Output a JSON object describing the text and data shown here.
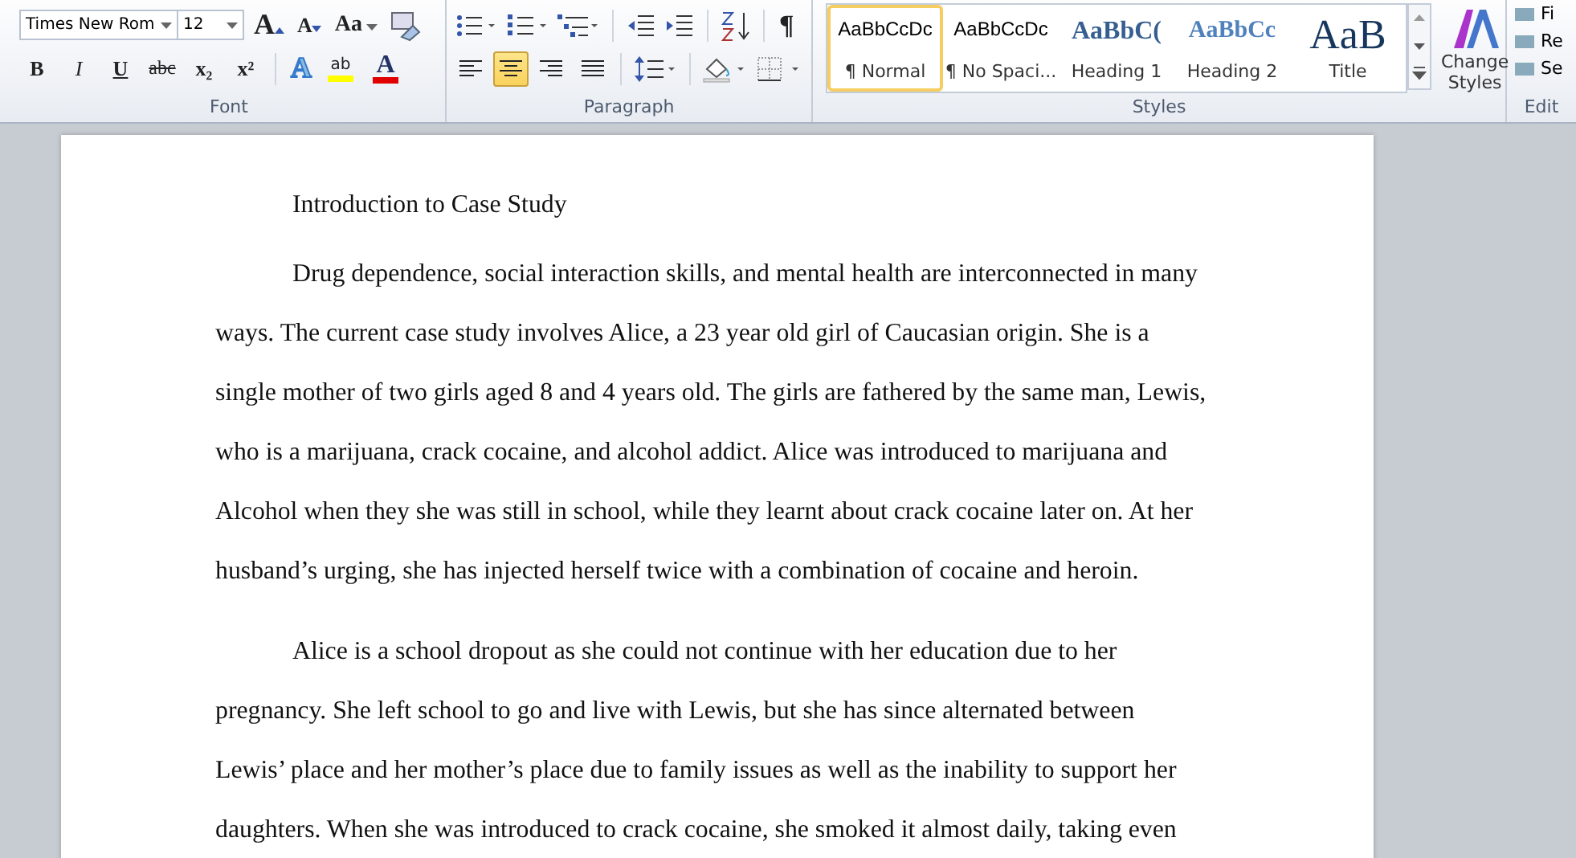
{
  "ribbon": {
    "font": {
      "font_name": "Times New Rom",
      "font_size": "12",
      "grow_label": "A",
      "shrink_label": "A",
      "case_label": "Aa",
      "format_buttons": [
        {
          "label": "B",
          "kind": "bold"
        },
        {
          "label": "I",
          "kind": "italic"
        },
        {
          "label": "U",
          "kind": "underline"
        },
        {
          "label": "abc",
          "kind": "strike"
        },
        {
          "label": "x₂",
          "kind": "sub"
        },
        {
          "label": "x²",
          "kind": "sup"
        }
      ],
      "effects_label": "A",
      "highlight_label": "ab",
      "font_color_label": "A",
      "group_label": "Font"
    },
    "paragraph": {
      "alignments": [
        {
          "kind": "left",
          "selected": false
        },
        {
          "kind": "center",
          "selected": true
        },
        {
          "kind": "right",
          "selected": false
        },
        {
          "kind": "justify",
          "selected": false
        }
      ],
      "pilcrow": "¶",
      "group_label": "Paragraph"
    },
    "styles": {
      "items": [
        {
          "sample": "AaBbCcDc",
          "name": "¶ Normal",
          "kind": "normal",
          "selected": true
        },
        {
          "sample": "AaBbCcDc",
          "name": "¶ No Spaci...",
          "kind": "normal",
          "selected": false
        },
        {
          "sample": "AaBbC(",
          "name": "Heading 1",
          "kind": "heading1",
          "selected": false
        },
        {
          "sample": "AaBbCc",
          "name": "Heading 2",
          "kind": "heading2",
          "selected": false
        },
        {
          "sample": "AaB",
          "name": "Title",
          "kind": "title",
          "selected": false
        }
      ],
      "change_label": "Change Styles",
      "group_label": "Styles"
    },
    "editing": {
      "items": [
        "Fi",
        "Re",
        "Se"
      ],
      "group_label": "Edit"
    }
  },
  "document": {
    "title": "Introduction to Case Study",
    "paragraphs": [
      [
        "Drug dependence, social interaction skills, and mental health are interconnected in many",
        "ways. The current case study involves Alice, a 23 year old girl of Caucasian origin. She is a",
        "single mother of two girls aged 8 and 4 years old. The girls are fathered by the same man, Lewis,",
        "who is a marijuana, crack cocaine, and alcohol addict. Alice was introduced to marijuana and",
        "Alcohol when they she was still in school, while they learnt about crack cocaine later on. At her",
        "husband’s urging, she has injected herself twice with a combination of cocaine and heroin."
      ],
      [
        "Alice is a school dropout as she could not continue with her education due to her",
        "pregnancy. She left school to go and live with Lewis, but she has since alternated between",
        "Lewis’ place and her mother’s place due to family issues as well as the inability to support her",
        "daughters. When she was introduced to crack cocaine, she smoked it almost daily, taking even"
      ]
    ]
  }
}
